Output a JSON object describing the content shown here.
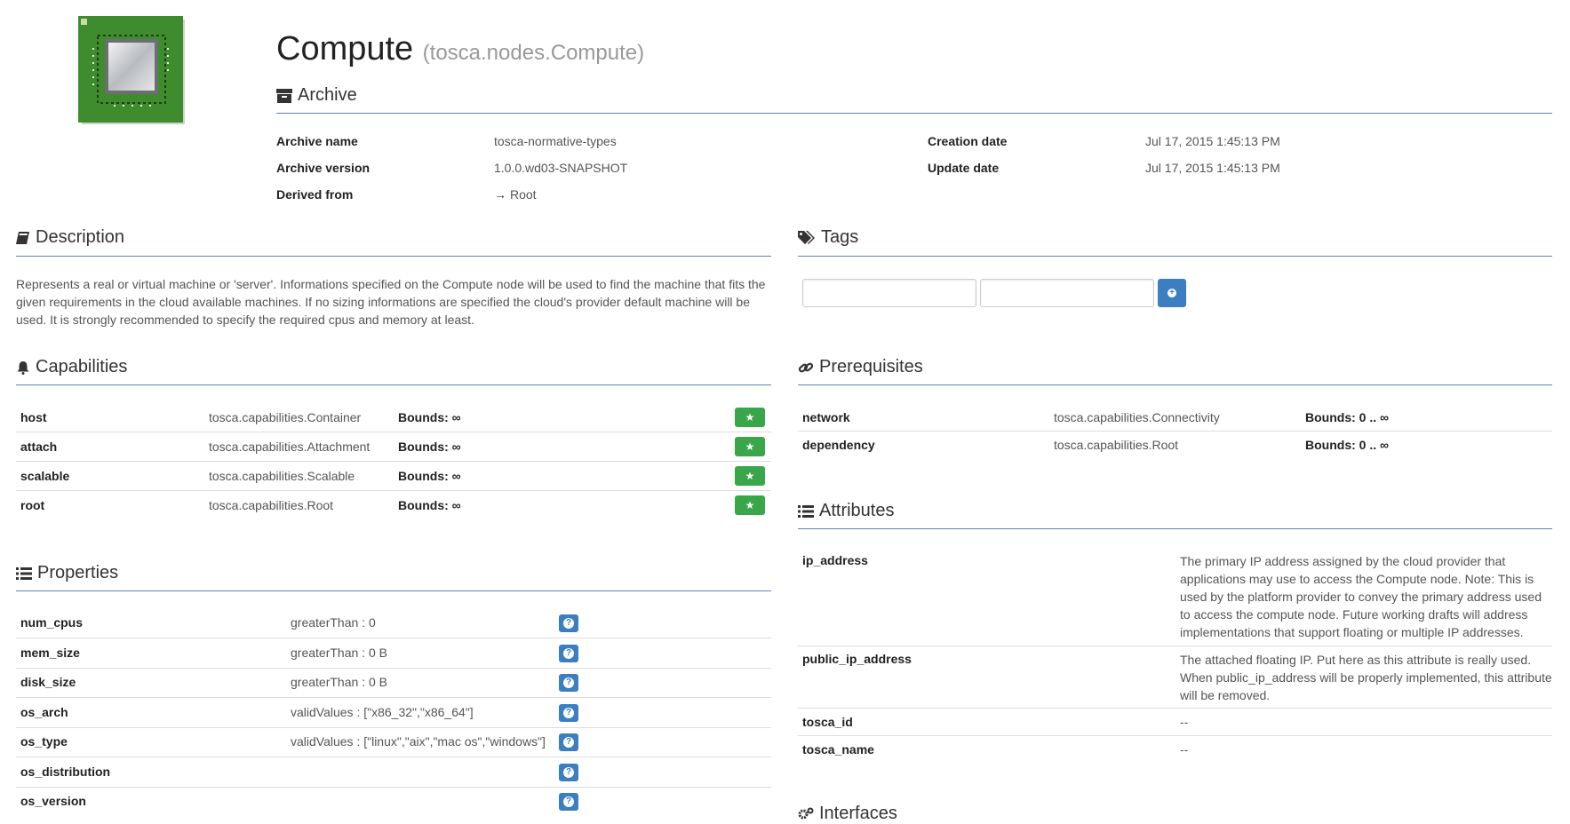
{
  "header": {
    "title": "Compute",
    "type_name": "(tosca.nodes.Compute)",
    "image_icon": "cpu-chip-icon"
  },
  "archive": {
    "title": "Archive",
    "name_label": "Archive name",
    "name_value": "tosca-normative-types",
    "version_label": "Archive version",
    "version_value": "1.0.0.wd03-SNAPSHOT",
    "derived_label": "Derived from",
    "derived_value": "Root",
    "creation_label": "Creation date",
    "creation_value": "Jul 17, 2015 1:45:13 PM",
    "update_label": "Update date",
    "update_value": "Jul 17, 2015 1:45:13 PM"
  },
  "description": {
    "title": "Description",
    "lines": [
      "Represents a real or virtual machine or 'server'. Informations specified on the Compute node will be used to find the machine that fits the",
      "given requirements in the cloud available machines. If no sizing informations are specified the cloud's provider default machine will be",
      "used. It is strongly recommended to specify the required cpus and memory at least."
    ]
  },
  "tags": {
    "title": "Tags",
    "key_value": "",
    "value_value": ""
  },
  "capabilities": {
    "title": "Capabilities",
    "rows": [
      {
        "name": "host",
        "type": "tosca.capabilities.Container",
        "bounds": "Bounds: ∞"
      },
      {
        "name": "attach",
        "type": "tosca.capabilities.Attachment",
        "bounds": "Bounds: ∞"
      },
      {
        "name": "scalable",
        "type": "tosca.capabilities.Scalable",
        "bounds": "Bounds: ∞"
      },
      {
        "name": "root",
        "type": "tosca.capabilities.Root",
        "bounds": "Bounds: ∞"
      }
    ]
  },
  "prerequisites": {
    "title": "Prerequisites",
    "rows": [
      {
        "name": "network",
        "type": "tosca.capabilities.Connectivity",
        "bounds": "Bounds: 0 .. ∞"
      },
      {
        "name": "dependency",
        "type": "tosca.capabilities.Root",
        "bounds": "Bounds: 0 .. ∞"
      }
    ]
  },
  "properties": {
    "title": "Properties",
    "rows": [
      {
        "name": "num_cpus",
        "constraint": "greaterThan : 0"
      },
      {
        "name": "mem_size",
        "constraint": "greaterThan : 0 B"
      },
      {
        "name": "disk_size",
        "constraint": "greaterThan : 0 B"
      },
      {
        "name": "os_arch",
        "constraint": "validValues : [\"x86_32\",\"x86_64\"]"
      },
      {
        "name": "os_type",
        "constraint": "validValues : [\"linux\",\"aix\",\"mac os\",\"windows\"]"
      },
      {
        "name": "os_distribution",
        "constraint": ""
      },
      {
        "name": "os_version",
        "constraint": ""
      }
    ]
  },
  "attributes": {
    "title": "Attributes",
    "rows": [
      {
        "name": "ip_address",
        "lines": [
          "The primary IP address assigned by the cloud provider that",
          "applications may use to access the Compute node. Note: This is",
          "used by the platform provider to convey the primary address used",
          "to access the compute node. Future working drafts will address",
          "implementations that support floating or multiple IP addresses."
        ]
      },
      {
        "name": "public_ip_address",
        "lines": [
          "The attached floating IP. Put here as this attribute is really used.",
          "When public_ip_address will be properly implemented, this attribute",
          "will be removed."
        ]
      },
      {
        "name": "tosca_id",
        "lines": [
          "--"
        ]
      },
      {
        "name": "tosca_name",
        "lines": [
          "--"
        ]
      }
    ]
  },
  "interfaces": {
    "title": "Interfaces"
  }
}
